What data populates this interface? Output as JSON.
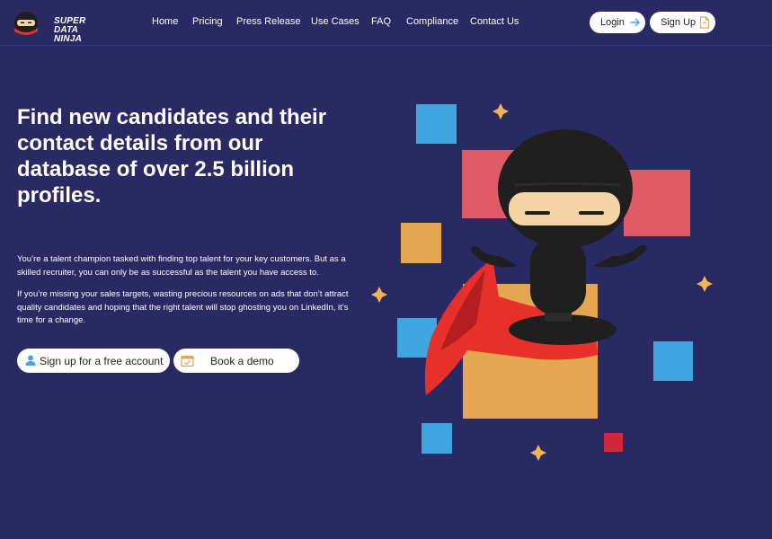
{
  "brand": {
    "line1": "SUPER",
    "line2": "DATA",
    "line3": "NINJA"
  },
  "nav": {
    "links": [
      "Home",
      "Pricing",
      "Press Release",
      "Use Cases",
      "FAQ",
      "Compliance",
      "Contact Us"
    ],
    "login_label": "Login",
    "signup_label": "Sign Up"
  },
  "hero": {
    "headline": "Find new candidates and their contact details from our database of over 2.5 billion profiles.",
    "paragraph1": "You’re a talent champion tasked with finding top talent for your key customers. But as a skilled recruiter, you can only be as successful as the talent you have access to.",
    "paragraph2": "If you’re missing your sales targets, wasting precious resources on ads that don’t attract quality candidates and hoping that the right talent will stop ghosting you on LinkedIn, it’s time for a change.",
    "cta_primary": "Sign up for a free account",
    "cta_secondary": "Book a demo"
  },
  "colors": {
    "background": "#292964",
    "blue_square": "#3fa6e0",
    "red_square": "#e05a68",
    "orange_square": "#e4a650",
    "dark_red_square": "#d0273a",
    "star": "#f0b455",
    "cape": "#e8302a",
    "ninja": "#1f1f1f",
    "face": "#f5d5a6"
  },
  "icons": {
    "login": "arrow-right-icon",
    "signup": "document-icon",
    "cta_primary": "user-icon",
    "cta_secondary": "calendar-icon"
  }
}
